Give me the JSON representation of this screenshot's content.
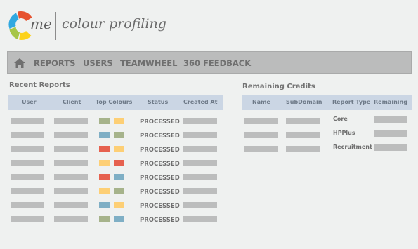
{
  "brand": {
    "prefix": "me",
    "title": "colour profiling"
  },
  "nav": {
    "items": [
      {
        "label": "REPORTS",
        "name": "nav-reports"
      },
      {
        "label": "USERS",
        "name": "nav-users"
      },
      {
        "label": "TEAMWHEEL",
        "name": "nav-teamwheel"
      },
      {
        "label": "360 FEEDBACK",
        "name": "nav-360-feedback"
      }
    ]
  },
  "recent": {
    "title": "Recent Reports",
    "columns": [
      "User",
      "Client",
      "Top Colours",
      "Status",
      "Created At"
    ],
    "rows": [
      {
        "status": "PROCESSED",
        "colours": [
          "#a6b38b",
          "#fdcf75"
        ]
      },
      {
        "status": "PROCESSED",
        "colours": [
          "#7fafc5",
          "#a6b38b"
        ]
      },
      {
        "status": "PROCESSED",
        "colours": [
          "#e6614f",
          "#fdcf75"
        ]
      },
      {
        "status": "PROCESSED",
        "colours": [
          "#fdcf75",
          "#e6614f"
        ]
      },
      {
        "status": "PROCESSED",
        "colours": [
          "#e6614f",
          "#7fafc5"
        ]
      },
      {
        "status": "PROCESSED",
        "colours": [
          "#fdcf75",
          "#a6b38b"
        ]
      },
      {
        "status": "PROCESSED",
        "colours": [
          "#7fafc5",
          "#fdcf75"
        ]
      },
      {
        "status": "PROCESSED",
        "colours": [
          "#a6b38b",
          "#7fafc5"
        ]
      }
    ]
  },
  "credits": {
    "title": "Remaining Credits",
    "columns": [
      "Name",
      "SubDomain",
      "Report Type",
      "Remaining"
    ],
    "rows": [
      {
        "type": "Core"
      },
      {
        "type": "HPPlus"
      },
      {
        "type": "Recruitment"
      }
    ]
  },
  "colors": {
    "logo": [
      "#e6522f",
      "#fcd21b",
      "#a7c646",
      "#30a8e0"
    ],
    "header_bar": "#cbd6e4",
    "nav_bar": "#bbbcbc"
  }
}
